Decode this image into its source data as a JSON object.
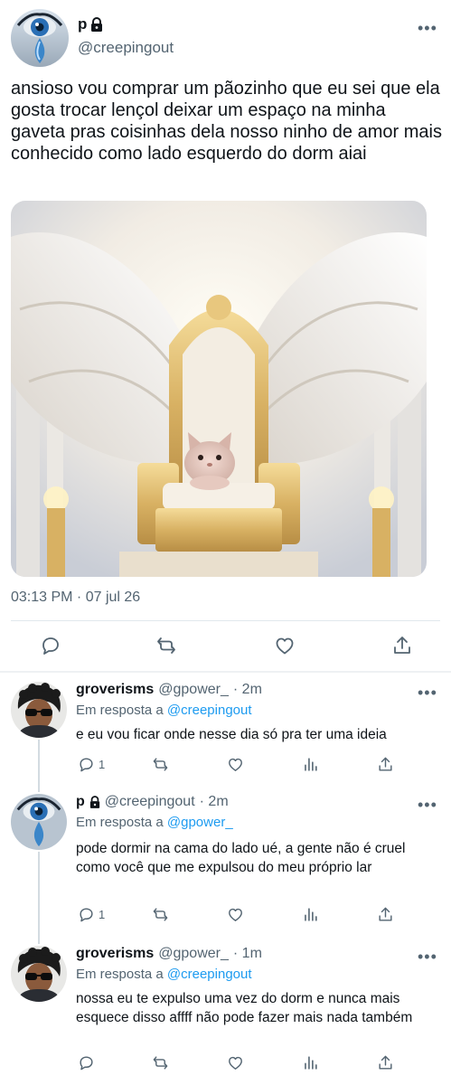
{
  "main_tweet": {
    "display_name": "p",
    "handle": "@creepingout",
    "text": "ansioso vou comprar um pãozinho que eu sei que ela gosta trocar lençol deixar um espaço na minha gaveta pras coisinhas dela nosso ninho de amor mais conhecido como lado esquerdo do dorm aiai",
    "timestamp": "03:13 PM · 07 jul 26",
    "more_label": "•••"
  },
  "replies": [
    {
      "display_name": "groverisms",
      "handle": "@gpower_",
      "time": "· 2m",
      "reply_prefix": "Em resposta a ",
      "reply_to": "@creepingout",
      "text": "e eu vou ficar onde nesse dia só pra ter uma ideia",
      "reply_count": "1",
      "avatar": "groverisms-avatar"
    },
    {
      "display_name": "p",
      "handle": "@creepingout",
      "time": "· 2m",
      "reply_prefix": "Em resposta a ",
      "reply_to": "@gpower_",
      "text": "pode dormir na cama do lado ué, a gente não é cruel como você que me expulsou do meu próprio lar",
      "reply_count": "1",
      "avatar": "creepingout-avatar"
    },
    {
      "display_name": "groverisms",
      "handle": "@gpower_",
      "time": "· 1m",
      "reply_prefix": "Em resposta a ",
      "reply_to": "@creepingout",
      "text": "nossa eu te expulso uma vez do dorm e nunca mais esquece disso affff não pode fazer mais nada também",
      "reply_count": "",
      "avatar": "groverisms-avatar"
    }
  ],
  "icons": [
    "reply-icon",
    "retweet-icon",
    "like-icon",
    "share-icon",
    "analytics-icon",
    "lock-icon",
    "more-icon"
  ],
  "colors": {
    "link": "#1d9bf0",
    "secondary_text": "#536471",
    "divider": "#e1e8ed"
  }
}
